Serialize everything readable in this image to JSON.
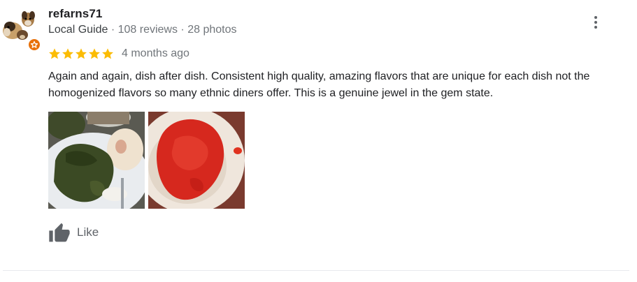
{
  "review": {
    "author": "refarns71",
    "author_meta": {
      "badge": "Local Guide",
      "separator": " · ",
      "reviews": "108 reviews",
      "photos": "28 photos"
    },
    "rating": 5,
    "rating_max": 5,
    "time": "4 months ago",
    "text": "Again and again, dish after dish. Consistent high quality, amazing flavors that are unique for each dish not the homogenized flavors so many ethnic diners offer. This is a genuine jewel in the gem state.",
    "like_label": "Like"
  },
  "icons": {
    "avatar": "dog-avatar",
    "badge": "local-guide-star-icon",
    "more": "more-vert-icon",
    "star": "star-icon",
    "like": "thumb-up-icon"
  },
  "colors": {
    "star": "#fbbc04",
    "badge": "#e8710a",
    "secondary_text": "#70757a",
    "icon_gray": "#5f6368"
  }
}
